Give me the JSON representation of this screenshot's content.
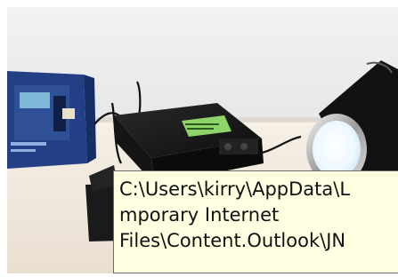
{
  "tooltip": {
    "lines": [
      "C:\\Users\\kirry\\AppData\\L",
      "mporary Internet",
      "Files\\Content.Outlook\\JN"
    ]
  },
  "colors": {
    "tooltip_background": "#ffffe1",
    "wall": "#ececee",
    "table": "#f1eadf",
    "box_blue": "#1f3f86",
    "box_panel": "#7fb7d8",
    "inverter_body": "#171717",
    "inverter_label": "#8fd46a",
    "lamp_body": "#121212",
    "lamp_glow": "#f4fbff"
  },
  "icons": [
    "inverter-device",
    "blue-product-box",
    "led-spotlight",
    "power-cable"
  ]
}
